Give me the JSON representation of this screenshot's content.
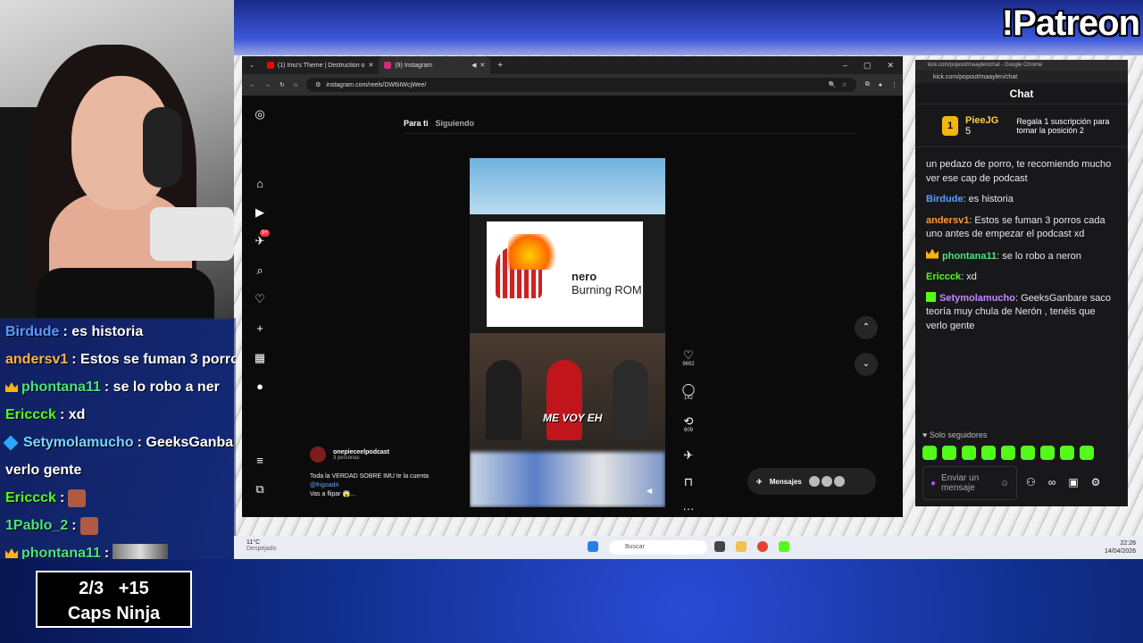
{
  "overlay_top_right": "!Patreon",
  "stream_chat": [
    {
      "user": "Birdude",
      "text": ": es historia",
      "color": "#5b9cff"
    },
    {
      "user": "andersv1",
      "text": ": Estos se fuman 3 porro",
      "color": "#ffb347"
    },
    {
      "user": "phontana11",
      "text": ": se lo robo a ner",
      "color": "#4be37a",
      "badges": true
    },
    {
      "user": "Ericcck",
      "text": ": xd",
      "color": "#53fc18"
    },
    {
      "user": "Setymolamucho",
      "text": ": GeeksGanba",
      "color": "#7ad3ff",
      "cube": true
    },
    {
      "user": "",
      "text": "verlo gente",
      "color": "#fff"
    },
    {
      "user": "Ericcck",
      "text": ":",
      "color": "#53fc18",
      "emote": true
    },
    {
      "user": "1Pablo_2",
      "text": ":",
      "color": "#4be37a",
      "emote": true
    },
    {
      "user": "phontana11",
      "text": ":",
      "color": "#4be37a",
      "badges": true,
      "emote_wide": true
    }
  ],
  "caps_box": {
    "line1": "2/3   +15",
    "line2": "Caps Ninja"
  },
  "browser": {
    "tabs": [
      "(1) Imu's Theme | Destruction o",
      "(9) Instagram"
    ],
    "url": "instagram.com/reels/DW6iIWcjWee/",
    "window_controls": [
      "–",
      "▢",
      "✕"
    ]
  },
  "instagram": {
    "feed_tabs": {
      "active": "Para ti",
      "other": "Siguiendo"
    },
    "badge": "9+",
    "reel": {
      "nero_brand": "nero",
      "nero_product": "Burning ROM",
      "overlay_text": "ME VOY EH"
    },
    "actions": {
      "likes": "9692",
      "comments": "142",
      "reposts": "609"
    },
    "author": {
      "name": "onepieceelpodcast",
      "sub": "3 personas"
    },
    "caption": {
      "line1": "Toda la VERDAD SOBRE IMU te la cuenta",
      "mention": "@frigoadri",
      "line2": "Vas a flipar 😱..."
    },
    "messages": {
      "label": "Mensajes",
      "badge": "9+"
    }
  },
  "kick": {
    "window_title": "kick.com/popout/maaylen/chat - Google Chrome",
    "url": "kick.com/popout/maaylen/chat",
    "header": "Chat",
    "top_gifter": {
      "rank": "1",
      "name": "PieeJG",
      "count": "5",
      "cta": "Regala 1 suscripción para tomar la posición 2"
    },
    "messages": [
      {
        "user": "",
        "text": "un pedazo de porro, te recomiendo mucho ver ese cap de podcast"
      },
      {
        "user": "Birdude",
        "text": ": es historia",
        "cls": "u1"
      },
      {
        "user": "andersv1",
        "text": ": Estos se fuman 3 porros cada uno antes de empezar el podcast xd",
        "cls": "u2"
      },
      {
        "user": "phontana11",
        "text": ": se lo robo a neron",
        "cls": "u4",
        "badges": true
      },
      {
        "user": "Ericcck",
        "text": ": xd",
        "cls": "u3"
      },
      {
        "user": "Setymolamucho",
        "text": ": GeeksGanbare saco teoría muy chula de Nerón , tenéis que verlo gente",
        "cls": "u5",
        "tag": true
      },
      {
        "user": "Ericcck",
        "text": ":",
        "cls": "u3",
        "emote": true
      },
      {
        "user": "1Pablo_2",
        "text": ":",
        "cls": "u4",
        "emote": true
      },
      {
        "user": "phontana11",
        "text": ":",
        "cls": "u4",
        "badges": true,
        "emote_wide": true
      }
    ],
    "followers_only": "Solo seguidores",
    "input_placeholder": "Enviar un mensaje"
  },
  "taskbar": {
    "temp": "11°C",
    "weather": "Despejado",
    "search": "Buscar",
    "time": "22:26",
    "date": "14/04/2026"
  },
  "colors": {
    "kick_green": "#53fc18",
    "instagram_badge": "#ff3040"
  }
}
